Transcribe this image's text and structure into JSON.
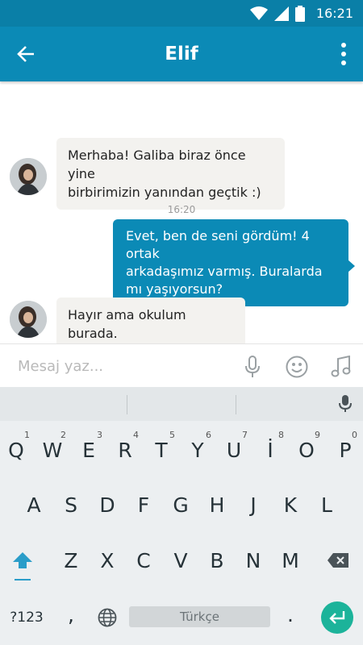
{
  "status": {
    "time": "16:21"
  },
  "header": {
    "title": "Elif"
  },
  "messages": [
    {
      "from": "Elif",
      "line1": "Merhaba! Galiba biraz önce yine",
      "line2": "birbirimizin yanından geçtik :)"
    },
    {
      "timestamp": "16:20"
    },
    {
      "from": "me",
      "line1": "Evet, ben de seni gördüm! 4 ortak",
      "line2": "arkadaşımız varmış. Buralarda",
      "line3": "mı yaşıyorsun?"
    },
    {
      "from": "Elif",
      "line1": "Hayır ama okulum burada."
    }
  ],
  "composer": {
    "placeholder": "Mesaj yaz..."
  },
  "keyboard": {
    "row1": [
      "Q",
      "W",
      "E",
      "R",
      "T",
      "Y",
      "U",
      "İ",
      "O",
      "P"
    ],
    "row1_hints": [
      "1",
      "2",
      "3",
      "4",
      "5",
      "6",
      "7",
      "8",
      "9",
      "0"
    ],
    "row2": [
      "A",
      "S",
      "D",
      "F",
      "G",
      "H",
      "J",
      "K",
      "L"
    ],
    "row3": [
      "Z",
      "X",
      "C",
      "V",
      "B",
      "N",
      "M"
    ],
    "symbols": "?123",
    "comma": ",",
    "period": ".",
    "space_label": "Türkçe"
  },
  "colors": {
    "header": "#0b8ab6",
    "status_bar": "#0a7fa7",
    "outgoing_bubble": "#0b8ab6",
    "incoming_bubble": "#f3f2ef",
    "enter_key": "#1cb39a"
  }
}
